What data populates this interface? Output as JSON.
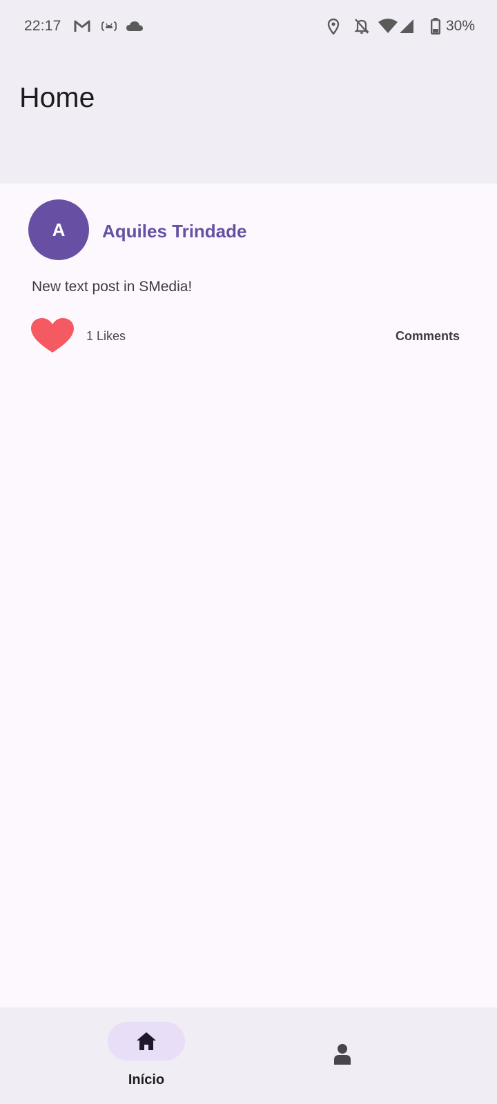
{
  "status_bar": {
    "time": "22:17",
    "battery_percent": "30%",
    "icons": [
      "gmail-icon",
      "android-debug-icon",
      "cloud-icon",
      "location-icon",
      "notifications-off-icon",
      "wifi-icon",
      "signal-icon",
      "battery-icon"
    ]
  },
  "header": {
    "title": "Home"
  },
  "post": {
    "avatar_initial": "A",
    "author": "Aquiles Trindade",
    "text": "New text post in SMedia!",
    "likes": "1 Likes",
    "comments_label": "Comments",
    "liked": true
  },
  "bottom_nav": {
    "items": [
      {
        "label": "Início",
        "icon": "home-icon",
        "selected": true
      },
      {
        "label": "",
        "icon": "person-icon",
        "selected": false
      }
    ]
  },
  "colors": {
    "accent": "#6750a4",
    "heart": "#f55a62",
    "surface": "#f1edf5",
    "background": "#fdf8fd",
    "nav_indicator": "#e8def8"
  }
}
